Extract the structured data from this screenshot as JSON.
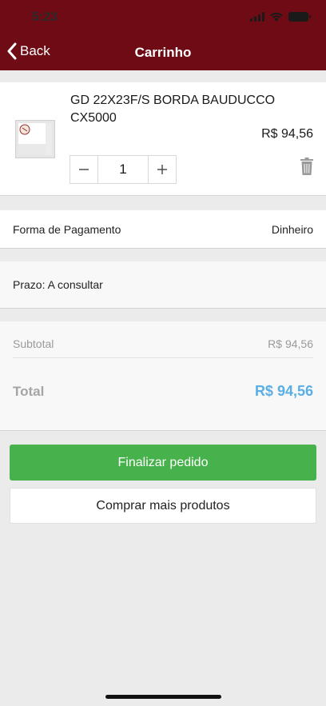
{
  "status_bar": {
    "time": "5:23"
  },
  "nav": {
    "back_label": "Back",
    "title": "Carrinho"
  },
  "cart_item": {
    "name": "GD 22X23F/S BORDA BAUDUCCO CX5000",
    "price": "R$ 94,56",
    "quantity": "1"
  },
  "payment": {
    "label": "Forma de Pagamento",
    "value": "Dinheiro"
  },
  "prazo": {
    "text": "Prazo: A consultar"
  },
  "totals": {
    "subtotal_label": "Subtotal",
    "subtotal_value": "R$ 94,56",
    "total_label": "Total",
    "total_value": "R$ 94,56"
  },
  "actions": {
    "finalize_label": "Finalizar pedido",
    "continue_label": "Comprar mais produtos"
  },
  "colors": {
    "header": "#6e0b14",
    "finalize_button": "#47b24c",
    "total_value": "#5aaee6"
  }
}
